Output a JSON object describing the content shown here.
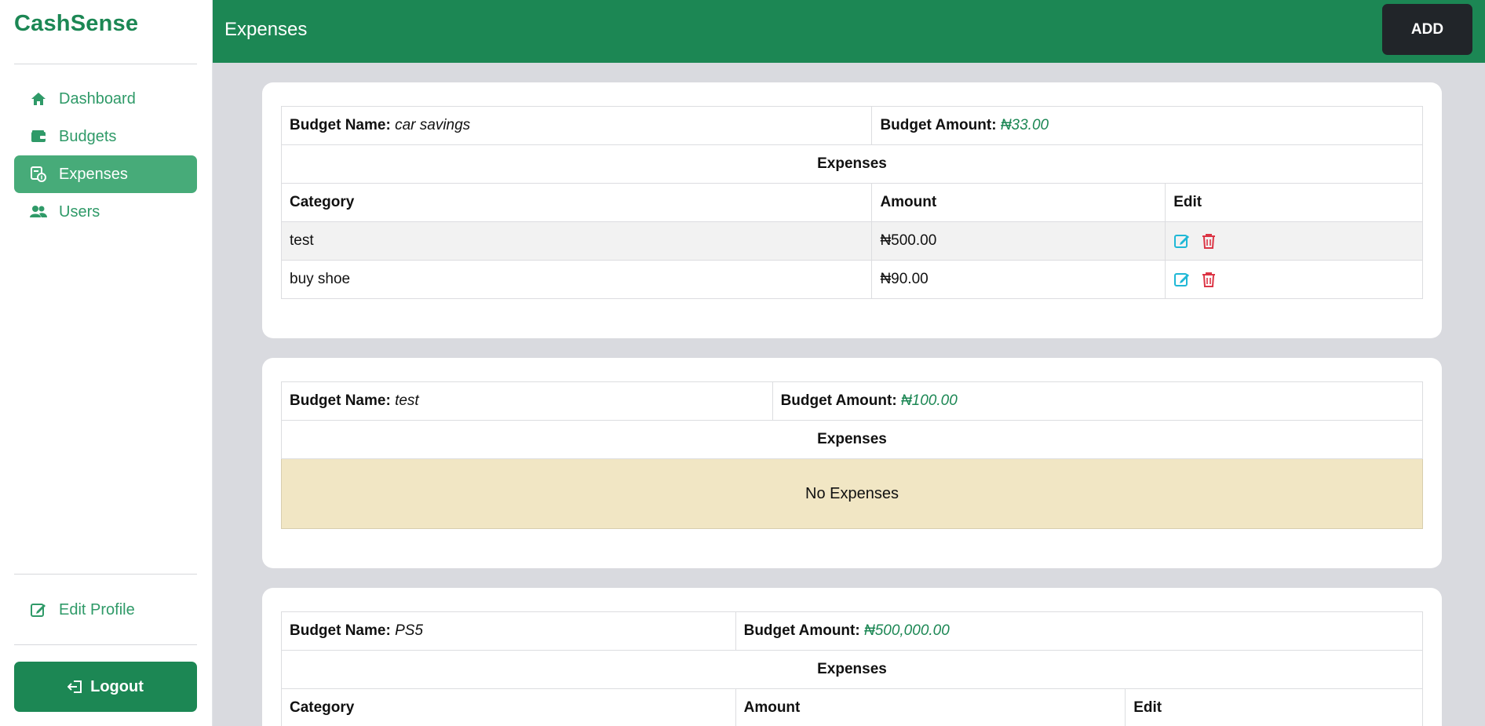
{
  "brand": "CashSense",
  "colors": {
    "primary": "#1c8754",
    "active_nav": "#47ab79",
    "amount": "#1c8754",
    "edit_icon": "#1fb8d6",
    "delete_icon": "#dc3545",
    "empty_row": "#f1e6c4"
  },
  "sidebar": {
    "items": [
      {
        "label": "Dashboard",
        "icon": "home-icon"
      },
      {
        "label": "Budgets",
        "icon": "wallet-icon"
      },
      {
        "label": "Expenses",
        "icon": "receipt-icon"
      },
      {
        "label": "Users",
        "icon": "users-icon"
      }
    ],
    "active_item": "Expenses",
    "edit_profile": "Edit Profile",
    "logout": "Logout"
  },
  "header": {
    "title": "Expenses",
    "add_label": "ADD"
  },
  "labels": {
    "budget_name": "Budget Name:",
    "budget_amount": "Budget Amount:",
    "expenses": "Expenses",
    "category": "Category",
    "amount": "Amount",
    "edit": "Edit",
    "no_expenses": "No Expenses"
  },
  "budgets": [
    {
      "name": "car savings",
      "amount": "₦33.00",
      "expenses": [
        {
          "category": "test",
          "amount": "₦500.00"
        },
        {
          "category": "buy shoe",
          "amount": "₦90.00"
        }
      ]
    },
    {
      "name": "test",
      "amount": "₦100.00",
      "expenses": []
    },
    {
      "name": "PS5",
      "amount": "₦500,000.00",
      "expenses": []
    }
  ]
}
